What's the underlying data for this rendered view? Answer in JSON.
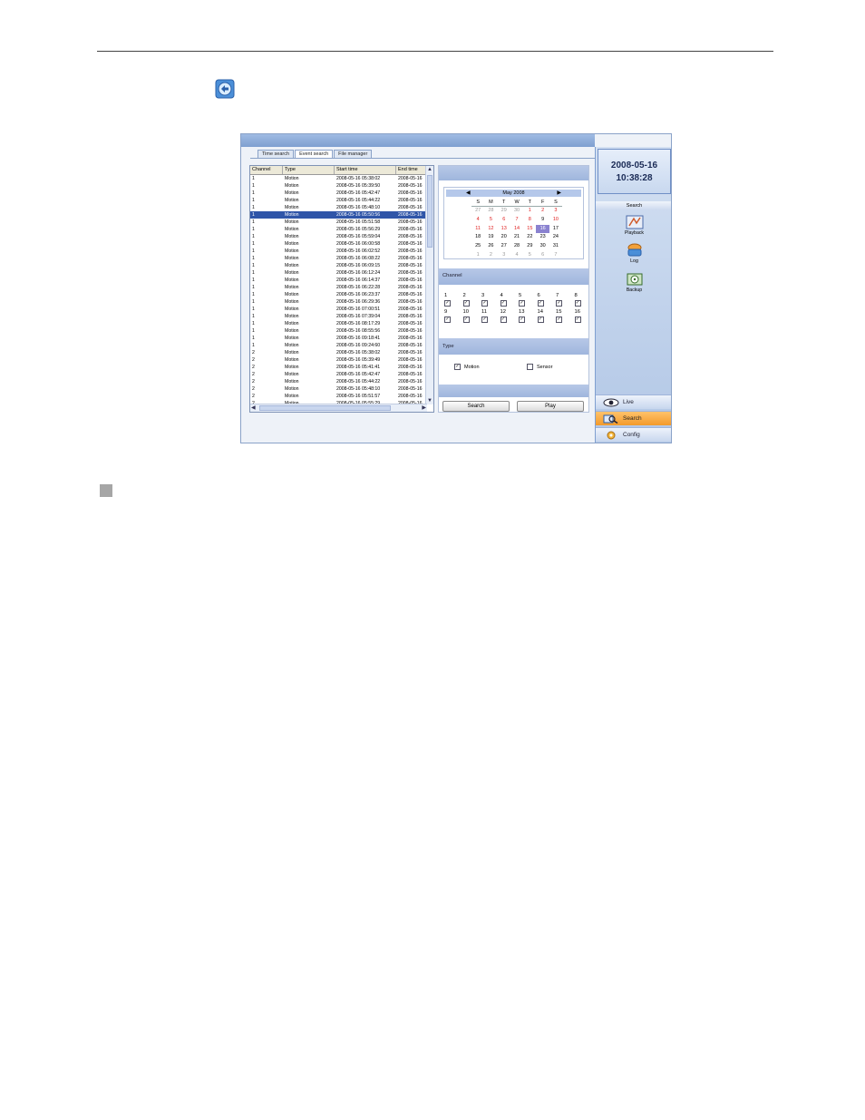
{
  "tabs": [
    "Time search",
    "Event search",
    "File manager"
  ],
  "list": {
    "headers": [
      "Channel",
      "Type",
      "Start time",
      "End time"
    ],
    "rows": [
      [
        "1",
        "Motion",
        "2008-05-16 05:38:02",
        "2008-05-16"
      ],
      [
        "1",
        "Motion",
        "2008-05-16 05:39:50",
        "2008-05-16"
      ],
      [
        "1",
        "Motion",
        "2008-05-16 05:42:47",
        "2008-05-16"
      ],
      [
        "1",
        "Motion",
        "2008-05-16 05:44:22",
        "2008-05-16"
      ],
      [
        "1",
        "Motion",
        "2008-05-16 05:48:10",
        "2008-05-16"
      ],
      [
        "1",
        "Motion",
        "2008-05-16 05:50:56",
        "2008-05-16"
      ],
      [
        "1",
        "Motion",
        "2008-05-16 05:51:58",
        "2008-05-16"
      ],
      [
        "1",
        "Motion",
        "2008-05-16 05:56:29",
        "2008-05-16"
      ],
      [
        "1",
        "Motion",
        "2008-05-16 05:59:04",
        "2008-05-16"
      ],
      [
        "1",
        "Motion",
        "2008-05-16 06:00:58",
        "2008-05-16"
      ],
      [
        "1",
        "Motion",
        "2008-05-16 06:02:52",
        "2008-05-16"
      ],
      [
        "1",
        "Motion",
        "2008-05-16 06:08:22",
        "2008-05-16"
      ],
      [
        "1",
        "Motion",
        "2008-05-16 06:09:15",
        "2008-05-16"
      ],
      [
        "1",
        "Motion",
        "2008-05-16 06:12:24",
        "2008-05-16"
      ],
      [
        "1",
        "Motion",
        "2008-05-16 06:14:37",
        "2008-05-16"
      ],
      [
        "1",
        "Motion",
        "2008-05-16 06:22:28",
        "2008-05-16"
      ],
      [
        "1",
        "Motion",
        "2008-05-16 06:23:37",
        "2008-05-16"
      ],
      [
        "1",
        "Motion",
        "2008-05-16 06:29:36",
        "2008-05-16"
      ],
      [
        "1",
        "Motion",
        "2008-05-16 07:00:51",
        "2008-05-16"
      ],
      [
        "1",
        "Motion",
        "2008-05-16 07:39:04",
        "2008-05-16"
      ],
      [
        "1",
        "Motion",
        "2008-05-16 08:17:29",
        "2008-05-16"
      ],
      [
        "1",
        "Motion",
        "2008-05-16 08:55:56",
        "2008-05-16"
      ],
      [
        "1",
        "Motion",
        "2008-05-16 09:18:41",
        "2008-05-16"
      ],
      [
        "1",
        "Motion",
        "2008-05-16 09:24:60",
        "2008-05-16"
      ],
      [
        "2",
        "Motion",
        "2008-05-16 05:38:02",
        "2008-05-16"
      ],
      [
        "2",
        "Motion",
        "2008-05-16 05:39:49",
        "2008-05-16"
      ],
      [
        "2",
        "Motion",
        "2008-05-16 05:41:41",
        "2008-05-16"
      ],
      [
        "2",
        "Motion",
        "2008-05-16 05:42:47",
        "2008-05-16"
      ],
      [
        "2",
        "Motion",
        "2008-05-16 05:44:22",
        "2008-05-16"
      ],
      [
        "2",
        "Motion",
        "2008-05-16 05:48:10",
        "2008-05-16"
      ],
      [
        "2",
        "Motion",
        "2008-05-16 05:51:57",
        "2008-05-16"
      ],
      [
        "2",
        "Motion",
        "2008-05-16 05:55:29",
        "2008-05-16"
      ]
    ],
    "selected_row": 5
  },
  "calendar": {
    "month_label": "May 2008",
    "weekdays": [
      "S",
      "M",
      "T",
      "W",
      "T",
      "F",
      "S"
    ],
    "days": [
      {
        "d": "27",
        "k": "other"
      },
      {
        "d": "28",
        "k": "other"
      },
      {
        "d": "29",
        "k": "other"
      },
      {
        "d": "30",
        "k": "other"
      },
      {
        "d": "1",
        "k": "red"
      },
      {
        "d": "2",
        "k": "red"
      },
      {
        "d": "3",
        "k": "red"
      },
      {
        "d": "4",
        "k": "red"
      },
      {
        "d": "5",
        "k": "red"
      },
      {
        "d": "6",
        "k": "red"
      },
      {
        "d": "7",
        "k": "red"
      },
      {
        "d": "8",
        "k": "red"
      },
      {
        "d": "9",
        "k": ""
      },
      {
        "d": "10",
        "k": "red"
      },
      {
        "d": "11",
        "k": "red"
      },
      {
        "d": "12",
        "k": "red"
      },
      {
        "d": "13",
        "k": "red"
      },
      {
        "d": "14",
        "k": "red"
      },
      {
        "d": "15",
        "k": "red"
      },
      {
        "d": "16",
        "k": "today"
      },
      {
        "d": "17",
        "k": ""
      },
      {
        "d": "18",
        "k": ""
      },
      {
        "d": "19",
        "k": ""
      },
      {
        "d": "20",
        "k": ""
      },
      {
        "d": "21",
        "k": ""
      },
      {
        "d": "22",
        "k": ""
      },
      {
        "d": "23",
        "k": ""
      },
      {
        "d": "24",
        "k": ""
      },
      {
        "d": "25",
        "k": ""
      },
      {
        "d": "26",
        "k": ""
      },
      {
        "d": "27",
        "k": ""
      },
      {
        "d": "28",
        "k": ""
      },
      {
        "d": "29",
        "k": ""
      },
      {
        "d": "30",
        "k": ""
      },
      {
        "d": "31",
        "k": ""
      },
      {
        "d": "1",
        "k": "other"
      },
      {
        "d": "2",
        "k": "other"
      },
      {
        "d": "3",
        "k": "other"
      },
      {
        "d": "4",
        "k": "other"
      },
      {
        "d": "5",
        "k": "other"
      },
      {
        "d": "6",
        "k": "other"
      },
      {
        "d": "7",
        "k": "other"
      }
    ]
  },
  "channel": {
    "label": "Channel",
    "channels": [
      "1",
      "2",
      "3",
      "4",
      "5",
      "6",
      "7",
      "8",
      "9",
      "10",
      "11",
      "12",
      "13",
      "14",
      "15",
      "16"
    ]
  },
  "type": {
    "label": "Type",
    "motion_label": "Motion",
    "sensor_label": "Sensor"
  },
  "buttons": {
    "search": "Search",
    "play": "Play"
  },
  "clock": {
    "date": "2008-05-16",
    "time": "10:38:28"
  },
  "sidebar": {
    "header": "Search",
    "items": [
      "Playback",
      "Log",
      "Backup"
    ]
  },
  "nav": {
    "live": "Live",
    "search": "Search",
    "config": "Config"
  },
  "colors": {
    "accent": "#f39a2b",
    "selection": "#2f55a8",
    "frame": "#7f9fd0"
  }
}
